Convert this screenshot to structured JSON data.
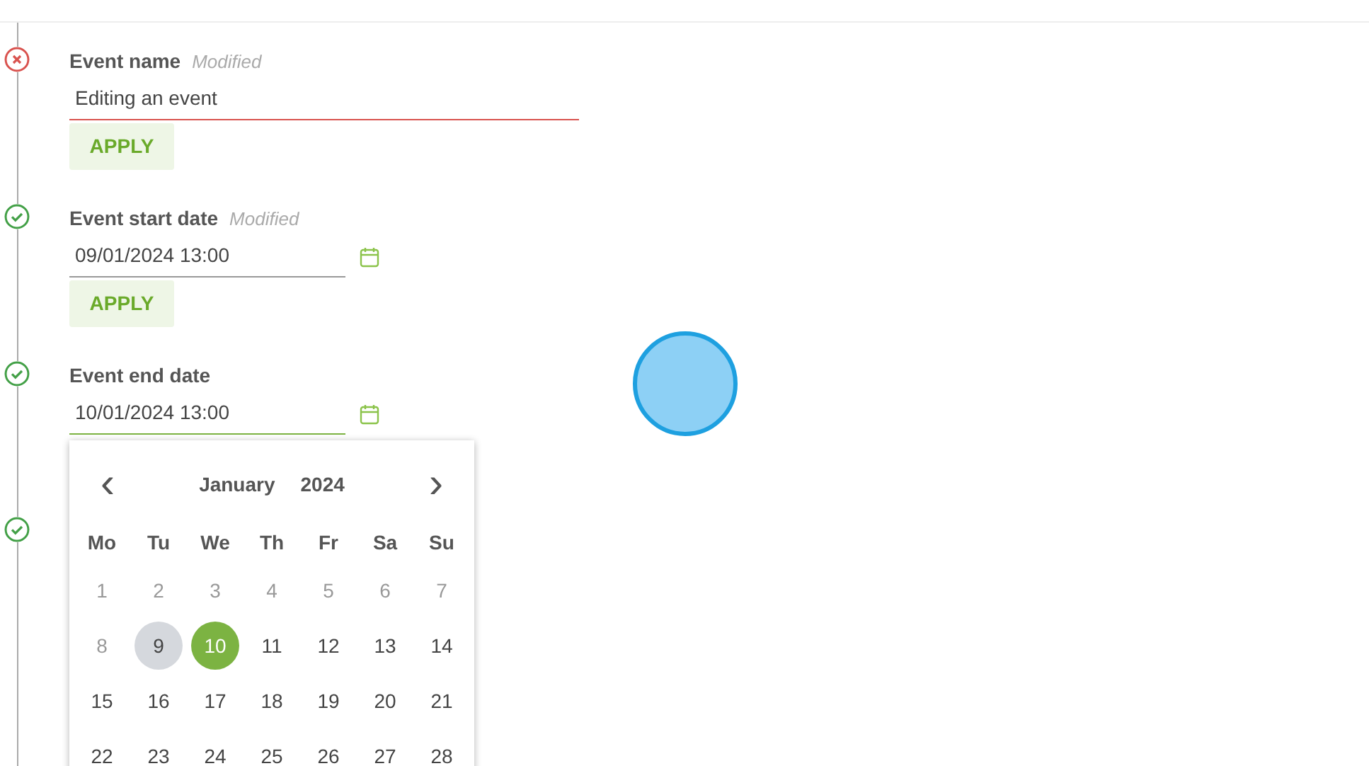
{
  "steps": [
    {
      "valid": false,
      "label": "Event name",
      "note": "Modified",
      "field": {
        "value": "Editing an event",
        "kind": "text",
        "focused": false
      },
      "apply": "APPLY"
    },
    {
      "valid": true,
      "label": "Event start date",
      "note": "Modified",
      "field": {
        "value": "09/01/2024 13:00",
        "kind": "date",
        "focused": false
      },
      "apply": "APPLY"
    },
    {
      "valid": true,
      "label": "Event end date",
      "field": {
        "value": "10/01/2024 13:00",
        "kind": "date",
        "focused": true
      }
    },
    {
      "valid": true
    }
  ],
  "calendar": {
    "prev": "‹",
    "next": "›",
    "month": "January",
    "year": "2024",
    "weekdays": [
      "Mo",
      "Tu",
      "We",
      "Th",
      "Fr",
      "Sa",
      "Su"
    ],
    "days": [
      {
        "label": "1",
        "muted": true,
        "highlighted": false,
        "selected": false
      },
      {
        "label": "2",
        "muted": true,
        "highlighted": false,
        "selected": false
      },
      {
        "label": "3",
        "muted": true,
        "highlighted": false,
        "selected": false
      },
      {
        "label": "4",
        "muted": true,
        "highlighted": false,
        "selected": false
      },
      {
        "label": "5",
        "muted": true,
        "highlighted": false,
        "selected": false
      },
      {
        "label": "6",
        "muted": true,
        "highlighted": false,
        "selected": false
      },
      {
        "label": "7",
        "muted": true,
        "highlighted": false,
        "selected": false
      },
      {
        "label": "8",
        "muted": true,
        "highlighted": false,
        "selected": false
      },
      {
        "label": "9",
        "muted": false,
        "highlighted": true,
        "selected": false
      },
      {
        "label": "10",
        "muted": false,
        "highlighted": false,
        "selected": true
      },
      {
        "label": "11",
        "muted": false,
        "highlighted": false,
        "selected": false
      },
      {
        "label": "12",
        "muted": false,
        "highlighted": false,
        "selected": false
      },
      {
        "label": "13",
        "muted": false,
        "highlighted": false,
        "selected": false
      },
      {
        "label": "14",
        "muted": false,
        "highlighted": false,
        "selected": false
      },
      {
        "label": "15",
        "muted": false,
        "highlighted": false,
        "selected": false
      },
      {
        "label": "16",
        "muted": false,
        "highlighted": false,
        "selected": false
      },
      {
        "label": "17",
        "muted": false,
        "highlighted": false,
        "selected": false
      },
      {
        "label": "18",
        "muted": false,
        "highlighted": false,
        "selected": false
      },
      {
        "label": "19",
        "muted": false,
        "highlighted": false,
        "selected": false
      },
      {
        "label": "20",
        "muted": false,
        "highlighted": false,
        "selected": false
      },
      {
        "label": "21",
        "muted": false,
        "highlighted": false,
        "selected": false
      },
      {
        "label": "22",
        "muted": false,
        "highlighted": false,
        "selected": false
      },
      {
        "label": "23",
        "muted": false,
        "highlighted": false,
        "selected": false
      },
      {
        "label": "24",
        "muted": false,
        "highlighted": false,
        "selected": false
      },
      {
        "label": "25",
        "muted": false,
        "highlighted": false,
        "selected": false
      },
      {
        "label": "26",
        "muted": false,
        "highlighted": false,
        "selected": false
      },
      {
        "label": "27",
        "muted": false,
        "highlighted": false,
        "selected": false
      },
      {
        "label": "28",
        "muted": false,
        "highlighted": false,
        "selected": false
      }
    ]
  }
}
